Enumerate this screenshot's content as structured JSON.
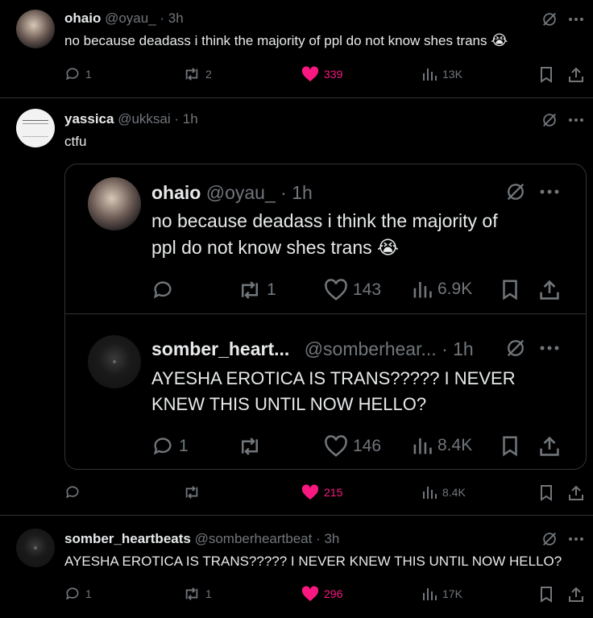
{
  "tweet1": {
    "name": "ohaio",
    "handle": "@oyau_",
    "time": "· 3h",
    "text": "no because deadass i think the majority of ppl do not know shes trans",
    "emoji": "😭",
    "replies": "1",
    "retweets": "2",
    "likes": "339",
    "views": "13K"
  },
  "tweet2": {
    "name": "yassica",
    "handle": "@ukksai",
    "time": "· 1h",
    "text": "ctfu",
    "likes": "215",
    "views": "8.4K",
    "quoted1": {
      "name": "ohaio",
      "handle": "@oyau_",
      "time": "· 1h",
      "text_line1": "no because deadass i think the majority of",
      "text_line2": "ppl do not know shes trans",
      "emoji": "😭",
      "retweets": "1",
      "likes": "143",
      "views": "6.9K"
    },
    "quoted2": {
      "name": "somber_heart...",
      "handle": "@somberhear...",
      "time": "· 1h",
      "text_line1": "AYESHA EROTICA IS TRANS????? I NEVER",
      "text_line2": "KNEW THIS UNTIL NOW HELLO?",
      "replies": "1",
      "likes": "146",
      "views": "8.4K"
    }
  },
  "tweet3": {
    "name": "somber_heartbeats",
    "handle": "@somberheartbeat",
    "time": "· 3h",
    "text": "AYESHA EROTICA IS TRANS????? I NEVER KNEW THIS UNTIL NOW HELLO?",
    "replies": "1",
    "retweets": "1",
    "likes": "296",
    "views": "17K"
  },
  "colors": {
    "background": "#000000",
    "text": "#e7e9ea",
    "muted": "#71767b",
    "like_active": "#f91880",
    "border": "#2f3336"
  }
}
